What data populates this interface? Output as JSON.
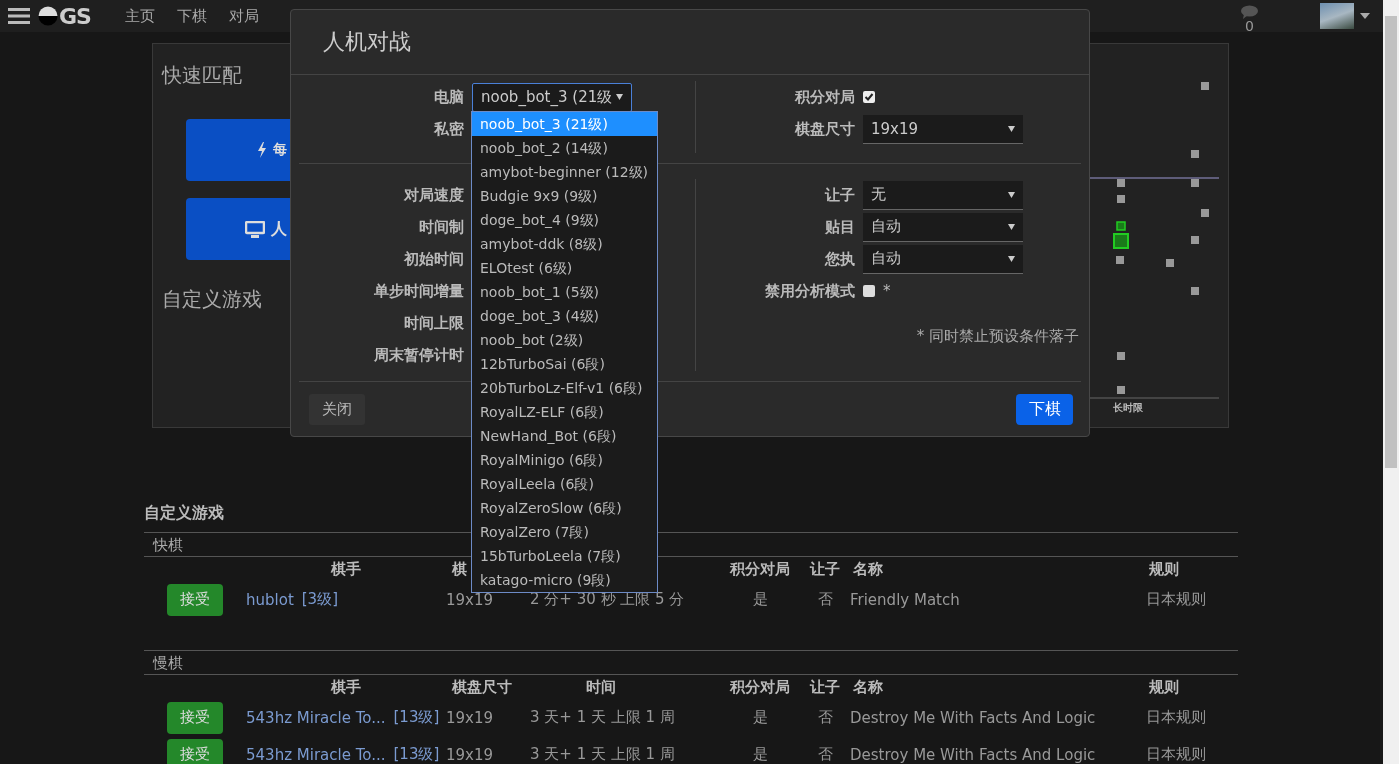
{
  "nav": {
    "logo": "GS",
    "items": [
      "主页",
      "下棋",
      "对局"
    ],
    "chat_count": "0"
  },
  "quick_match": {
    "title": "快速匹配",
    "buttons": [
      {
        "kind": "quick",
        "label": "每"
      },
      {
        "kind": "computer",
        "label": "人"
      }
    ],
    "custom_title": "自定义游戏"
  },
  "chart": {
    "axis_label": "长时限"
  },
  "modal": {
    "title": "人机对战",
    "sections": [
      {
        "left": [
          {
            "label": "电脑",
            "kind": "select",
            "value": "noob_bot_3 (21级",
            "focused": true
          },
          {
            "label": "私密",
            "kind": "label"
          }
        ],
        "right": [
          {
            "label": "积分对局",
            "kind": "checkbox",
            "checked": true
          },
          {
            "label": "棋盘尺寸",
            "kind": "select",
            "value": "19x19",
            "focused": false
          }
        ]
      },
      {
        "left": [
          {
            "label": "对局速度",
            "kind": "label"
          },
          {
            "label": "时间制",
            "kind": "label"
          },
          {
            "label": "初始时间",
            "kind": "label"
          },
          {
            "label": "单步时间增量",
            "kind": "label"
          },
          {
            "label": "时间上限",
            "kind": "label"
          },
          {
            "label": "周末暂停计时",
            "kind": "label"
          }
        ],
        "right": [
          {
            "label": "让子",
            "kind": "select",
            "value": "无",
            "focused": false
          },
          {
            "label": "贴目",
            "kind": "select",
            "value": "自动",
            "focused": false
          },
          {
            "label": "您执",
            "kind": "select",
            "value": "自动",
            "focused": false
          },
          {
            "label": "禁用分析模式",
            "kind": "checkbox",
            "checked": false,
            "suffix": "*"
          }
        ],
        "note": "* 同时禁止预设条件落子"
      }
    ],
    "dropdown": {
      "options": [
        {
          "label": "noob_bot_3 (21级)",
          "selected": true
        },
        {
          "label": "noob_bot_2 (14级)",
          "selected": false
        },
        {
          "label": "amybot-beginner (12级)",
          "selected": false
        },
        {
          "label": "Budgie 9x9 (9级)",
          "selected": false
        },
        {
          "label": "doge_bot_4 (9级)",
          "selected": false
        },
        {
          "label": "amybot-ddk (8级)",
          "selected": false
        },
        {
          "label": "ELOtest (6级)",
          "selected": false
        },
        {
          "label": "noob_bot_1 (5级)",
          "selected": false
        },
        {
          "label": "doge_bot_3 (4级)",
          "selected": false
        },
        {
          "label": "noob_bot (2级)",
          "selected": false
        },
        {
          "label": "12bTurboSai (6段)",
          "selected": false
        },
        {
          "label": "20bTurboLz-Elf-v1 (6段)",
          "selected": false
        },
        {
          "label": "RoyalLZ-ELF (6段)",
          "selected": false
        },
        {
          "label": "NewHand_Bot (6段)",
          "selected": false
        },
        {
          "label": "RoyalMinigo (6段)",
          "selected": false
        },
        {
          "label": "RoyalLeela (6段)",
          "selected": false
        },
        {
          "label": "RoyalZeroSlow (6段)",
          "selected": false
        },
        {
          "label": "RoyalZero (7段)",
          "selected": false
        },
        {
          "label": "15bTurboLeela (7段)",
          "selected": false
        },
        {
          "label": "katago-micro (9段)",
          "selected": false
        }
      ]
    },
    "buttons": {
      "close": "关闭",
      "submit": "下棋"
    }
  },
  "games": {
    "title": "自定义游戏",
    "sections": [
      {
        "title": "快棋",
        "columns": [
          "棋手",
          "棋",
          null,
          "积分对局",
          "让子",
          "名称",
          "规则"
        ],
        "rows": [
          {
            "accept": "接受",
            "player": "hublot",
            "rank": "[3级]",
            "size": "19x19",
            "time": "2 分+ 30 秒 上限 5 分",
            "rated": "是",
            "handicap": "否",
            "name": "Friendly Match",
            "rules": "日本规则"
          }
        ]
      },
      {
        "title": "慢棋",
        "columns": [
          "棋手",
          "棋盘尺寸",
          "时间",
          "积分对局",
          "让子",
          "名称",
          "规则"
        ],
        "rows": [
          {
            "accept": "接受",
            "player": "543hz Miracle To...",
            "rank": "[13级]",
            "size": "19x19",
            "time": "3 天+ 1 天 上限 1 周",
            "rated": "是",
            "handicap": "否",
            "name": "Destroy Me With Facts And Logic",
            "rules": "日本规则"
          },
          {
            "accept": "接受",
            "player": "543hz Miracle To...",
            "rank": "[13级]",
            "size": "19x19",
            "time": "3 天+ 1 天 上限 1 周",
            "rated": "是",
            "handicap": "否",
            "name": "Destroy Me With Facts And Logic",
            "rules": "日本规则"
          }
        ]
      }
    ]
  }
}
